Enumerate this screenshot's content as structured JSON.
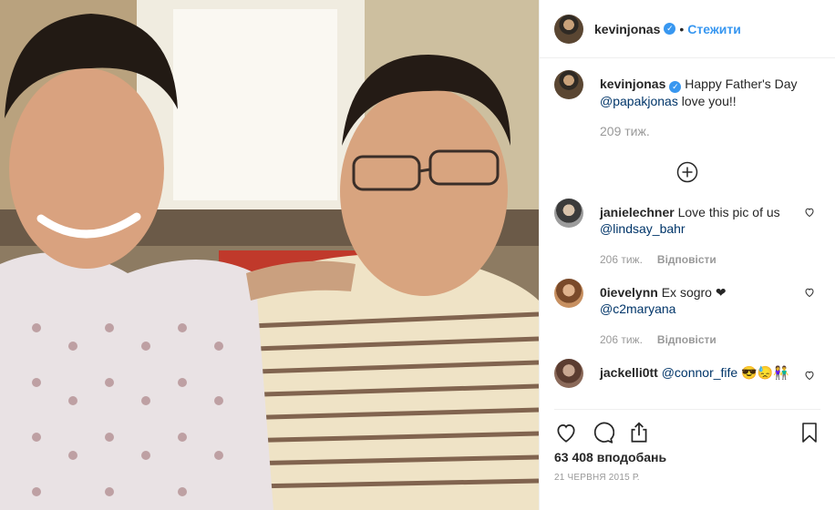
{
  "post": {
    "author": "kevinjonas",
    "follow_label": "Стежити",
    "caption_text": "Happy Father's Day",
    "caption_mention": "@papakjonas",
    "caption_tail": "love you!!",
    "caption_time": "209 тиж.",
    "likes": "63 408 вподобань",
    "date": "21 ЧЕРВНЯ 2015 Р."
  },
  "comments": [
    {
      "user": "janielechner",
      "text": "Love this pic of us",
      "mention": "@lindsay_bahr",
      "time": "206 тиж.",
      "reply": "Відповісти"
    },
    {
      "user": "0ievelynn",
      "text": "Ex sogro ❤",
      "mention": "@c2maryana",
      "time": "206 тиж.",
      "reply": "Відповісти"
    },
    {
      "user": "jackelli0tt",
      "mention": "@connor_fife",
      "text": "😎😓👫"
    }
  ],
  "icons": {
    "verified": "verified-badge-icon",
    "add_comment": "plus-circle-icon",
    "like": "heart-icon",
    "comment": "speech-bubble-icon",
    "share": "share-icon",
    "save": "bookmark-icon"
  },
  "colors": {
    "link": "#3897f0",
    "mention": "#003569",
    "muted": "#999999"
  }
}
